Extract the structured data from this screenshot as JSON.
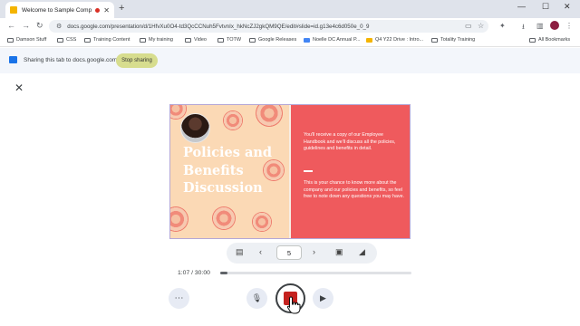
{
  "browser": {
    "tab_title": "Welcome to Sample Comp",
    "new_tab_icon": "plus-icon",
    "url": "docs.google.com/presentation/d/1HfvXu0O4-td3QcCCNuh5FvtvnIx_hkNcZJ2gkQM9QE/edit#slide=id.g13e4c6d050e_0_9",
    "window_controls": [
      "minimize-icon",
      "maximize-icon",
      "close-icon"
    ]
  },
  "bookmarks": [
    {
      "label": "Damson Stuff",
      "icon": "folder-icon"
    },
    {
      "label": "CSS",
      "icon": "folder-icon"
    },
    {
      "label": "Training Content",
      "icon": "folder-icon"
    },
    {
      "label": "My training",
      "icon": "folder-icon"
    },
    {
      "label": "Video",
      "icon": "folder-icon"
    },
    {
      "label": "TOTW",
      "icon": "folder-icon"
    },
    {
      "label": "Google Releases",
      "icon": "folder-icon"
    },
    {
      "label": "Noelle DC Annual P...",
      "icon": "doc-icon"
    },
    {
      "label": "Q4 Y22 Drive : Intro...",
      "icon": "slides-icon"
    },
    {
      "label": "Totality Training",
      "icon": "folder-icon"
    }
  ],
  "all_bookmarks": "All Bookmarks",
  "sharing": {
    "message": "Sharing this tab to docs.google.com",
    "stop_label": "Stop sharing"
  },
  "slide": {
    "title": "Policies and Benefits Discussion",
    "paragraph1": "You'll receive a copy of our Employee Handbook and we'll discuss all the policies, guidelines and benefits in detail.",
    "paragraph2": "This is your chance to know more about the company and our policies and benefits, so feel free to note down any questions you may have."
  },
  "slide_nav": {
    "page": "5"
  },
  "timer": {
    "label": "1:07 / 30:00",
    "progress": 0.037
  },
  "colors": {
    "slide_left": "#fbd9b5",
    "slide_right": "#ef5a5d",
    "record": "#c5221f",
    "stop_sharing_bg": "#d7dd8e"
  }
}
